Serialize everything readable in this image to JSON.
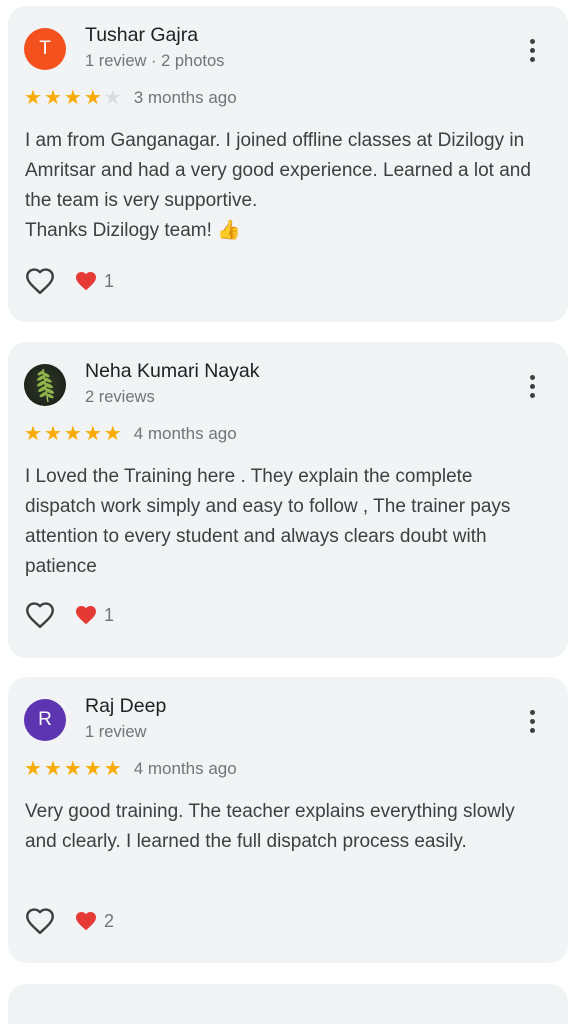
{
  "reviews": [
    {
      "avatar_letter": "T",
      "avatar_color": "#f4511e",
      "name": "Tushar Gajra",
      "meta": "1 review · 2 photos",
      "stars": 4,
      "time_ago": "3 months ago",
      "text_lines": [
        "I am from Ganganagar. I joined offline classes at Dizilogy in Amritsar and had a very good experience. Learned a lot and the team is very supportive.",
        "Thanks Dizilogy team! 👍"
      ],
      "reaction_count": "1"
    },
    {
      "avatar_letter": "",
      "avatar_color": "#2d3a25",
      "name": "Neha Kumari Nayak",
      "meta": "2 reviews",
      "stars": 5,
      "time_ago": "4 months ago",
      "text_lines": [
        "I Loved the Training here . They explain the complete dispatch work simply and easy to follow , The trainer pays attention to every student and always clears doubt with patience"
      ],
      "reaction_count": "1"
    },
    {
      "avatar_letter": "R",
      "avatar_color": "#5e35b1",
      "name": "Raj Deep",
      "meta": "1 review",
      "stars": 5,
      "time_ago": "4 months ago",
      "text_lines": [
        "Very good training. The teacher explains everything slowly and clearly. I learned the full dispatch process easily."
      ],
      "reaction_count": "2"
    }
  ],
  "colors": {
    "star_filled": "#f9ab00",
    "star_empty": "#dadce0",
    "heart_red": "#e53935",
    "card_background": "#f1f3f4"
  },
  "icons": {
    "more": "more-vert-icon",
    "like": "heart-outline-icon",
    "reaction": "red-heart-icon",
    "star": "star-icon"
  }
}
